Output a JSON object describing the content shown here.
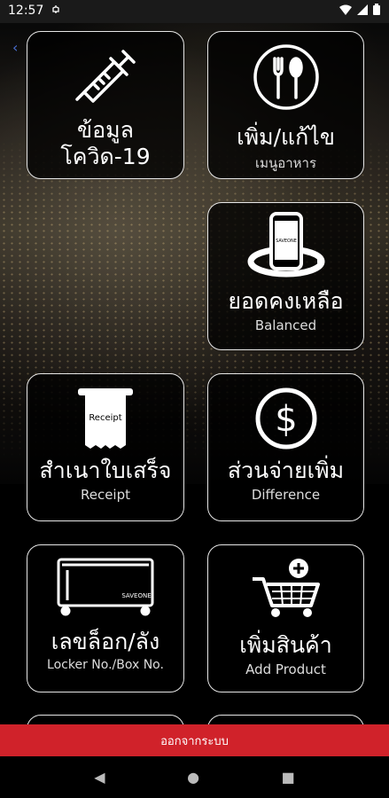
{
  "status": {
    "time": "12:57"
  },
  "tiles": {
    "covid": {
      "title_line1": "ข้อมูล",
      "title_line2": "โควิด-19"
    },
    "menu": {
      "title": "เพิ่ม/แก้ไข",
      "subtitle": "เมนูอาหาร"
    },
    "balance": {
      "title": "ยอดคงเหลือ",
      "subtitle": "Balanced",
      "phone_text": "SAVEONE"
    },
    "receipt": {
      "title": "สำเนาใบเสร็จ",
      "subtitle": "Receipt",
      "paper_text": "Receipt"
    },
    "difference": {
      "title": "ส่วนจ่ายเพิ่ม",
      "subtitle": "Difference"
    },
    "locker": {
      "title": "เลขล็อก/ลัง",
      "subtitle": "Locker No./Box No.",
      "box_text": "SAVEONE"
    },
    "add_product": {
      "title": "เพิ่มสินค้า",
      "subtitle": "Add Product"
    }
  },
  "logout_label": "ออกจากระบบ",
  "icons": [
    "syringe-icon",
    "fork-spoon-icon",
    "phone-rotate-icon",
    "receipt-icon",
    "dollar-icon",
    "locker-box-icon",
    "cart-add-icon"
  ]
}
